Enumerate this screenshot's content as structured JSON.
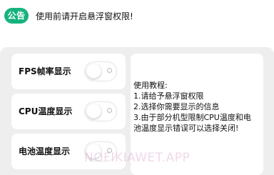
{
  "notice": {
    "badge": "公告",
    "text": "使用前请开启悬浮窗权限!"
  },
  "settings": [
    {
      "label": "FPS帧率显示",
      "enabled": false
    },
    {
      "label": "CPU温度显示",
      "enabled": false
    },
    {
      "label": "电池温度显示",
      "enabled": false
    }
  ],
  "tutorial": {
    "lines": [
      "使用教程:",
      "1.请给予悬浮窗权限",
      "2.选择你需要显示的信息",
      "3.由于部分机型限制CPU温度和电",
      "池温度显示错误可以选择关闭!"
    ]
  },
  "watermark": "NOFIKIAWET.APP",
  "colors": {
    "accent": "#16b27f",
    "panel_bg": "#eeeeee",
    "card_bg": "#ffffff"
  }
}
